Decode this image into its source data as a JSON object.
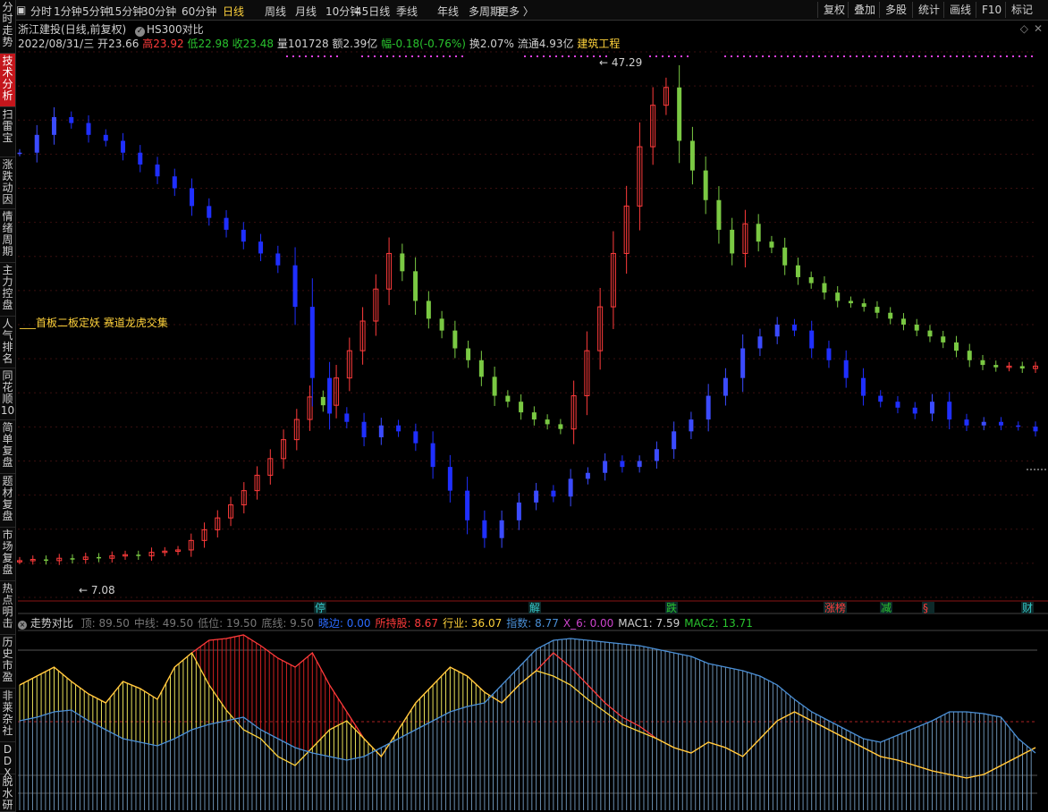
{
  "toolbar": {
    "periods": [
      "分时",
      "1分钟",
      "5分钟",
      "15分钟",
      "30分钟",
      "60分钟",
      "日线",
      "周线",
      "月线",
      "10分钟",
      "45日线",
      "季线",
      "年线",
      "多周期",
      "更多 〉"
    ],
    "active_period": "日线",
    "right_buttons": [
      "复权",
      "叠加",
      "多股",
      "统计",
      "画线",
      "F10",
      "标记"
    ]
  },
  "left_rail": [
    {
      "label": "分时走势",
      "active": false
    },
    {
      "label": "技术分析",
      "active": true
    },
    {
      "label": "扫雷宝",
      "active": false
    },
    {
      "label": "涨跌动因",
      "active": false
    },
    {
      "label": "情绪周期",
      "active": false
    },
    {
      "label": "主力控盘",
      "active": false
    },
    {
      "label": "人气排名",
      "active": false
    },
    {
      "label": "同花顺10",
      "active": false
    },
    {
      "label": "简单复盘",
      "active": false
    },
    {
      "label": "题材复盘",
      "active": false
    },
    {
      "label": "市场复盘",
      "active": false
    },
    {
      "label": "热点明击",
      "active": false
    },
    {
      "label": "历史市盈",
      "active": false
    },
    {
      "label": "非莱杂社",
      "active": false
    },
    {
      "label": "DDX",
      "active": false
    },
    {
      "label": "脱水研",
      "active": false
    }
  ],
  "header": {
    "stock_name": "浙江建投",
    "mode": "(日线,前复权)",
    "compare": "HS300对比",
    "date": "2022/08/31/三",
    "open_label": "开",
    "open": "23.66",
    "high_label": "高",
    "high": "23.92",
    "low_label": "低",
    "low": "22.98",
    "close_label": "收",
    "close": "23.48",
    "volume_label": "量",
    "volume": "101728",
    "amount_label": "额",
    "amount": "2.39亿",
    "change_label": "幅",
    "change": "-0.18(-0.76%)",
    "turnover_label": "换",
    "turnover": "2.07%",
    "float_label": "流通",
    "float": "4.93亿",
    "sector": "建筑工程"
  },
  "overlay_label": "___首板二板定妖 赛道龙虎交集",
  "markers": [
    {
      "text": "停",
      "color": "#36c4c4"
    },
    {
      "text": "解",
      "color": "#36c4c4"
    },
    {
      "text": "跌",
      "color": "#29c32e"
    },
    {
      "text": "涨榜",
      "color": "#ff3b3b"
    },
    {
      "text": "减",
      "color": "#29c32e"
    },
    {
      "text": "§",
      "color": "#ff3b3b"
    },
    {
      "text": "财",
      "color": "#36c4c4"
    }
  ],
  "indicator_bar": {
    "name": "走势对比",
    "items": [
      {
        "label": "顶:",
        "value": "89.50",
        "color": "#777777"
      },
      {
        "label": "中线:",
        "value": "49.50",
        "color": "#777777"
      },
      {
        "label": "低位:",
        "value": "19.50",
        "color": "#777777"
      },
      {
        "label": "底线:",
        "value": "9.50",
        "color": "#777777"
      },
      {
        "label": "晓边:",
        "value": "0.00",
        "color": "#2b6bff"
      },
      {
        "label": "所持股:",
        "value": "8.67",
        "color": "#ff3b3b"
      },
      {
        "label": "行业:",
        "value": "36.07",
        "color": "#ffd23b"
      },
      {
        "label": "指数:",
        "value": "8.77",
        "color": "#4a8fd6"
      },
      {
        "label": "X_6:",
        "value": "0.00",
        "color": "#cc44cc"
      },
      {
        "label": "MAC1:",
        "value": "7.59",
        "color": "#d0d0d0"
      },
      {
        "label": "MAC2:",
        "value": "13.71",
        "color": "#29c32e"
      }
    ]
  },
  "chart_data": {
    "type": "line",
    "title": "浙江建投 (日线,前复权) HS300对比",
    "price_annotations": {
      "max": "47.29",
      "min": "7.08"
    },
    "ylim": [
      4,
      50
    ],
    "series": [
      {
        "name": "浙江建投",
        "color": "#ff3b3b",
        "values": [
          7.1,
          7.2,
          7.1,
          7.3,
          7.2,
          7.4,
          7.3,
          7.5,
          7.6,
          7.5,
          7.8,
          7.9,
          8.0,
          8.8,
          9.7,
          10.7,
          11.8,
          13.0,
          14.3,
          15.7,
          17.3,
          19.0,
          20.9,
          20.2,
          22.5,
          24.8,
          27.3,
          30.0,
          33.0,
          31.5,
          29.0,
          27.5,
          26.5,
          25.0,
          24.0,
          22.6,
          21.0,
          20.5,
          19.6,
          19.0,
          18.6,
          18.2,
          21.0,
          24.8,
          28.5,
          33.0,
          37.0,
          42.0,
          45.5,
          47.0,
          42.5,
          40.0,
          37.5,
          35.0,
          33.0,
          35.5,
          34.0,
          33.5,
          32.0,
          31.0,
          30.5,
          29.7,
          29.0,
          28.8,
          28.5,
          28.0,
          27.5,
          27.0,
          26.5,
          26.0,
          25.5,
          24.8,
          24.0,
          23.6,
          23.4,
          23.5,
          23.3,
          23.5
        ]
      },
      {
        "name": "HS300",
        "color": "#2b3bff",
        "values": [
          41.5,
          43.0,
          44.5,
          44.0,
          43.0,
          42.5,
          41.5,
          40.5,
          39.5,
          38.5,
          37.0,
          36.0,
          35.0,
          34.0,
          33.0,
          32.0,
          28.5,
          22.5,
          19.5,
          18.8,
          17.5,
          18.5,
          18.0,
          17.0,
          15.0,
          13.0,
          10.5,
          9.0,
          10.5,
          12.0,
          13.0,
          12.5,
          14.0,
          14.5,
          15.5,
          15.0,
          15.5,
          16.5,
          18.0,
          19.0,
          21.0,
          22.5,
          25.0,
          26.0,
          27.0,
          26.5,
          25.0,
          24.0,
          22.5,
          21.0,
          20.5,
          20.0,
          19.5,
          20.5,
          19.0,
          18.5,
          18.8,
          18.5,
          18.4,
          18.0
        ]
      }
    ],
    "subchart": {
      "title": "走势对比",
      "ylim": [
        0,
        100
      ],
      "series": [
        {
          "name": "所持股",
          "color": "#ff3b3b",
          "values": [
            70,
            75,
            80,
            72,
            65,
            60,
            72,
            68,
            62,
            80,
            88,
            95,
            96,
            98,
            92,
            85,
            80,
            88,
            70,
            55,
            40,
            30,
            45,
            60,
            70,
            80,
            75,
            66,
            60,
            70,
            78,
            88,
            80,
            70,
            60,
            52,
            47,
            40,
            35,
            32,
            38,
            35,
            30,
            40,
            50,
            55,
            50,
            45,
            40,
            35,
            30,
            28,
            25,
            22,
            20,
            18,
            20,
            25,
            30,
            35
          ]
        },
        {
          "name": "行业",
          "color": "#ffd23b",
          "values": [
            70,
            75,
            80,
            72,
            65,
            60,
            72,
            68,
            62,
            80,
            88,
            70,
            56,
            45,
            40,
            30,
            25,
            35,
            45,
            50,
            40,
            30,
            45,
            60,
            70,
            80,
            75,
            66,
            60,
            70,
            78,
            75,
            70,
            62,
            55,
            48,
            44,
            40,
            35,
            32,
            38,
            35,
            30,
            40,
            50,
            55,
            50,
            45,
            40,
            35,
            30,
            28,
            25,
            22,
            20,
            18,
            20,
            25,
            30,
            35
          ]
        },
        {
          "name": "指数",
          "color": "#4a8fd6",
          "values": [
            50,
            52,
            55,
            56,
            50,
            45,
            40,
            38,
            36,
            40,
            45,
            48,
            50,
            52,
            45,
            40,
            35,
            32,
            30,
            28,
            30,
            35,
            40,
            45,
            50,
            55,
            58,
            60,
            70,
            80,
            90,
            95,
            96,
            95,
            94,
            93,
            92,
            90,
            88,
            86,
            82,
            80,
            78,
            75,
            70,
            62,
            55,
            50,
            45,
            40,
            38,
            42,
            46,
            50,
            55,
            55,
            54,
            52,
            40,
            32
          ]
        }
      ],
      "hlines": [
        89.5,
        49.5,
        19.5,
        9.5
      ]
    }
  }
}
